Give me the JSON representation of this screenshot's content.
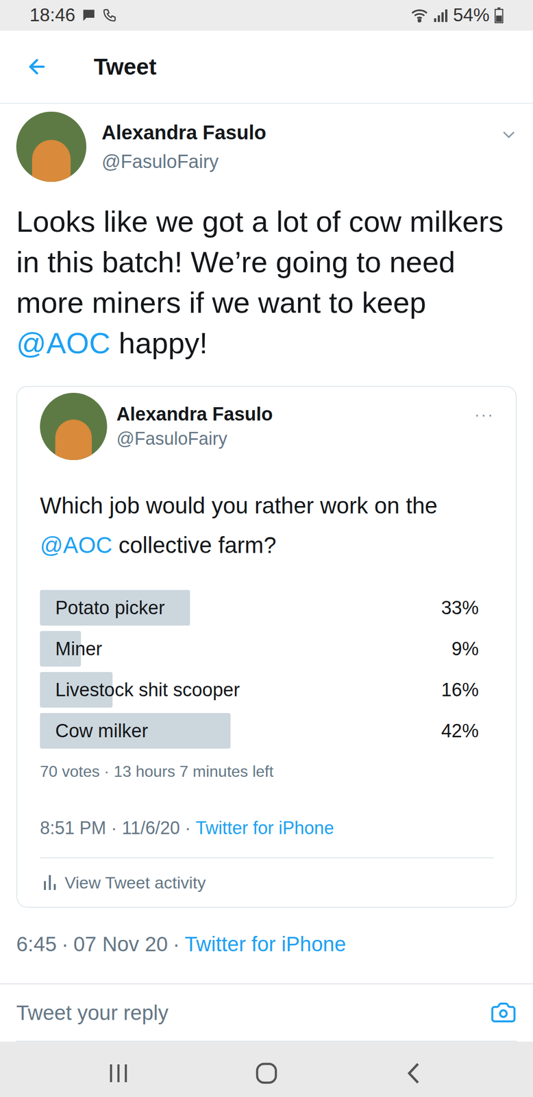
{
  "status_bar": {
    "time": "18:46",
    "battery": "54%",
    "battery_level": 0.54
  },
  "header": {
    "title": "Tweet"
  },
  "tweet": {
    "author": {
      "name": "Alexandra Fasulo",
      "handle": "@FasuloFairy"
    },
    "text": [
      {
        "kind": "text",
        "text": "Looks like we got a lot of cow milkers in this batch! We’re going to need more miners if we want to keep "
      },
      {
        "kind": "mention",
        "text": "@AOC"
      },
      {
        "kind": "text",
        "text": " happy!"
      }
    ],
    "quoted": {
      "author": {
        "name": "Alexandra Fasulo",
        "handle": "@FasuloFairy"
      },
      "menu": "···",
      "text": [
        {
          "kind": "text",
          "text": "Which job would you rather work on the "
        },
        {
          "kind": "mention",
          "text": "@AOC"
        },
        {
          "kind": "text",
          "text": " collective farm?"
        }
      ],
      "poll": {
        "options": [
          {
            "label": "Potato picker",
            "percent": "33%",
            "level": 0.33
          },
          {
            "label": "Miner",
            "percent": "9%",
            "level": 0.09
          },
          {
            "label": "Livestock shit scooper",
            "percent": "16%",
            "level": 0.16
          },
          {
            "label": "Cow milker",
            "percent": "42%",
            "level": 0.42
          }
        ],
        "summary": "70 votes · 13 hours 7 minutes left"
      },
      "meta": {
        "parts": [
          "8:51 PM",
          "11/6/20"
        ],
        "separator": "·",
        "source": "Twitter for iPhone"
      },
      "activity": "View Tweet activity"
    },
    "meta": {
      "parts": [
        "6:45",
        "07 Nov 20"
      ],
      "separator": "·",
      "source": "Twitter for iPhone"
    }
  },
  "reply": {
    "placeholder": "Tweet your reply"
  }
}
